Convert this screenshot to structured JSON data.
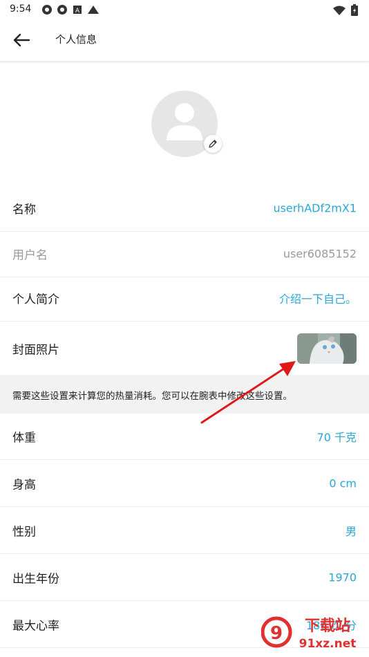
{
  "status_bar": {
    "time": "9:54"
  },
  "header": {
    "title": "个人信息"
  },
  "rows": [
    {
      "label": "名称",
      "value": "userhADf2mX1"
    },
    {
      "label": "用户名",
      "value": "user6085152"
    },
    {
      "label": "个人简介",
      "value": "介绍一下自己。"
    },
    {
      "label": "封面照片"
    }
  ],
  "note": "需要这些设置来计算您的热量消耗。您可以在腕表中修改这些设置。",
  "body_rows": [
    {
      "label": "体重",
      "value": "70 千克"
    },
    {
      "label": "身高",
      "value": "0 cm"
    },
    {
      "label": "性别",
      "value": "男"
    },
    {
      "label": "出生年份",
      "value": "1970"
    },
    {
      "label": "最大心率",
      "value": "180 次/分"
    }
  ],
  "watermark": {
    "text": "下载站",
    "url": "91xz.net"
  },
  "colors": {
    "accent": "#2aa6d6",
    "arrow": "#e01818",
    "note_bg": "#f2f2f2"
  }
}
